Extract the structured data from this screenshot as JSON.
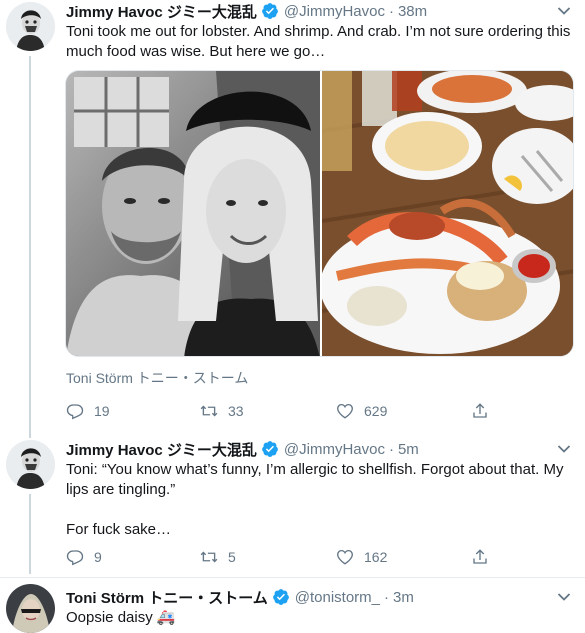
{
  "tweets": [
    {
      "name": "Jimmy Havoc ジミー大混乱",
      "handle": "@JimmyHavoc",
      "separator": "·",
      "time": "38m",
      "text": "Toni took me out for lobster. And shrimp. And crab. I’m not sure ordering this much food was wise. But here we go…",
      "tagged": "Toni Störm トニー・ストーム",
      "replies": "19",
      "retweets": "33",
      "likes": "629"
    },
    {
      "name": "Jimmy Havoc ジミー大混乱",
      "handle": "@JimmyHavoc",
      "separator": "·",
      "time": "5m",
      "text": "Toni: “You know what’s funny, I’m allergic to shellfish. Forgot about that. My lips are tingling.”",
      "text2": "For fuck sake…",
      "replies": "9",
      "retweets": "5",
      "likes": "162"
    },
    {
      "name": "Toni Störm トニー・ストーム",
      "handle": "@tonistorm_",
      "separator": "·",
      "time": "3m",
      "text": "Oopsie daisy 🚑"
    }
  ],
  "icons": {
    "verified": "verified-badge-icon",
    "reply": "reply-icon",
    "retweet": "retweet-icon",
    "like": "heart-icon",
    "share": "share-icon",
    "caret": "chevron-down-icon"
  },
  "colors": {
    "verified": "#1da1f2",
    "secondary_text": "#657786",
    "thread_line": "#ccd6dd"
  }
}
